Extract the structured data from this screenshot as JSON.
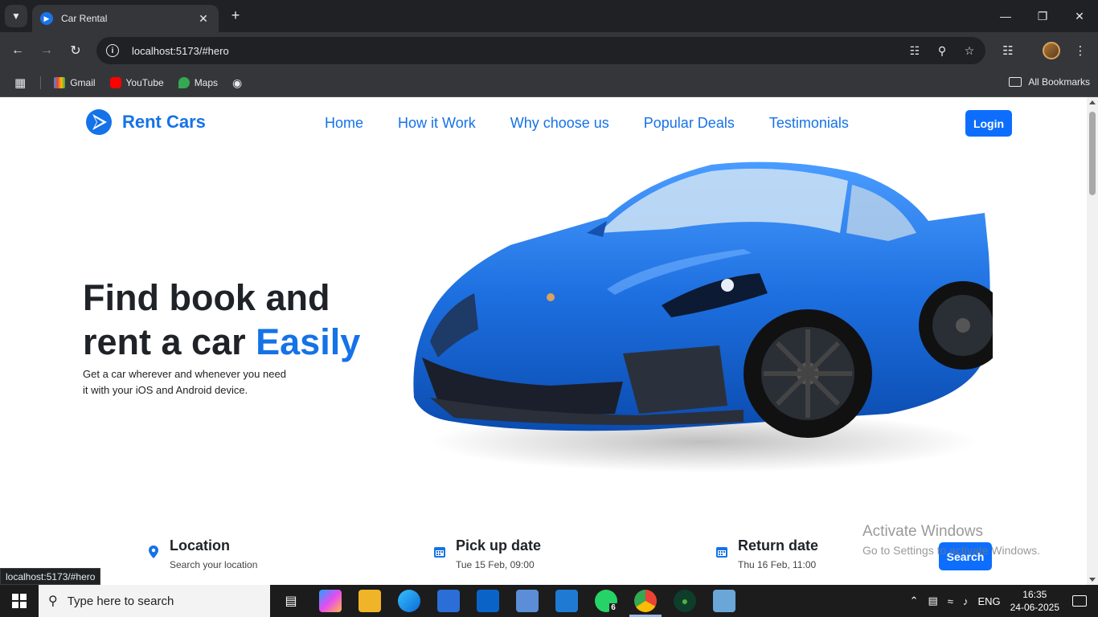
{
  "browser": {
    "tab_title": "Car Rental",
    "url": "localhost:5173/#hero",
    "bookmarks": [
      "Gmail",
      "YouTube",
      "Maps"
    ],
    "all_bookmarks": "All Bookmarks",
    "status_url": "localhost:5173/#hero"
  },
  "site": {
    "brand": "Rent Cars",
    "nav": [
      "Home",
      "How it Work",
      "Why choose us",
      "Popular Deals",
      "Testimonials"
    ],
    "login": "Login",
    "hero": {
      "title_line1": "Find book and",
      "title_line2": "rent a car ",
      "title_accent": "Easily",
      "subtitle": "Get a car wherever and whenever you need it with your iOS and Android device."
    },
    "search": {
      "location_label": "Location",
      "location_value": "Search your location",
      "pickup_label": "Pick up date",
      "pickup_value": "Tue 15 Feb, 09:00",
      "return_label": "Return date",
      "return_value": "Thu 16 Feb, 11:00",
      "button": "Search"
    },
    "colors": {
      "accent": "#1572e8",
      "button": "#0d6efd",
      "car": "#1d6fe0"
    }
  },
  "windows": {
    "activate_title": "Activate Windows",
    "activate_sub": "Go to Settings to activate Windows.",
    "search_placeholder": "Type here to search",
    "whatsapp_badge": "6",
    "lang": "ENG",
    "time": "16:35",
    "date": "24-06-2025"
  }
}
